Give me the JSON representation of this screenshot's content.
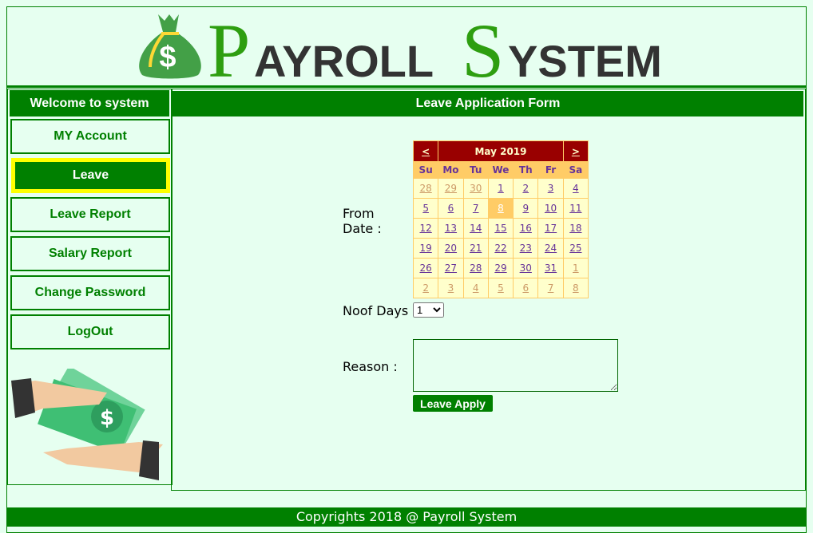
{
  "header": {
    "logo_text": "PAYROLL SYSTEM",
    "logo_first": "P",
    "logo_rest1": "AYROLL",
    "logo_second": "S",
    "logo_rest2": "YSTEM"
  },
  "sidebar": {
    "title": "Welcome to system",
    "items": [
      {
        "label": "MY Account"
      },
      {
        "label": "Leave",
        "active": true
      },
      {
        "label": "Leave Report"
      },
      {
        "label": "Salary Report"
      },
      {
        "label": "Change Password"
      },
      {
        "label": "LogOut"
      }
    ]
  },
  "main": {
    "title": "Leave Application Form",
    "from_date_label": "From Date :",
    "noof_days_label": "Noof Days :",
    "noof_days_value": "1",
    "reason_label": "Reason :",
    "reason_value": "",
    "apply_label": "Leave Apply"
  },
  "calendar": {
    "prev": "<",
    "next": ">",
    "month": "May 2019",
    "days": [
      "Su",
      "Mo",
      "Tu",
      "We",
      "Th",
      "Fr",
      "Sa"
    ],
    "weeks": [
      [
        "28",
        "29",
        "30",
        "1",
        "2",
        "3",
        "4"
      ],
      [
        "5",
        "6",
        "7",
        "8",
        "9",
        "10",
        "11"
      ],
      [
        "12",
        "13",
        "14",
        "15",
        "16",
        "17",
        "18"
      ],
      [
        "19",
        "20",
        "21",
        "22",
        "23",
        "24",
        "25"
      ],
      [
        "26",
        "27",
        "28",
        "29",
        "30",
        "31",
        "1"
      ],
      [
        "2",
        "3",
        "4",
        "5",
        "6",
        "7",
        "8"
      ]
    ],
    "selected": "8",
    "colors": {
      "title": "#990000",
      "header": "#ffcc66",
      "cell": "#ffffcc"
    }
  },
  "footer": {
    "text": "Copyrights 2018 @ Payroll System"
  },
  "colors": {
    "primary": "#008000",
    "active_border": "#ffff00",
    "background": "#e6fff0"
  }
}
